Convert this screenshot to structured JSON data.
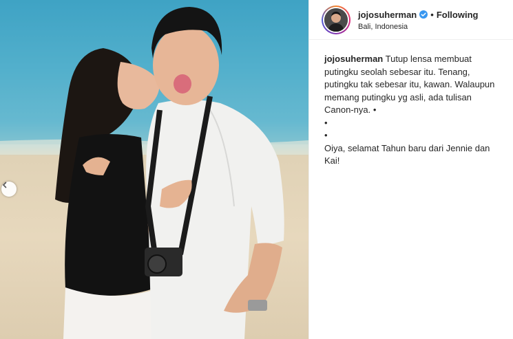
{
  "post": {
    "username": "jojosuherman",
    "verified": true,
    "separator": "•",
    "follow_status": "Following",
    "location": "Bali, Indonesia"
  },
  "caption": {
    "username": "jojosuherman",
    "lines": [
      "Tutup lensa membuat",
      "putingku seolah sebesar itu. Tenang,",
      "putingku tak sebesar itu, kawan. Walaupun",
      "memang putingku yg asli, ada tulisan",
      "Canon-nya. •",
      "•",
      "•",
      "Oiya, selamat Tahun baru dari Jennie dan",
      "Kai!"
    ]
  },
  "icons": {
    "verified": "verified-badge-icon",
    "carousel_prev": "chevron-left-icon"
  },
  "colors": {
    "verified_blue": "#3897f0",
    "text": "#262626",
    "border": "#efefef"
  }
}
